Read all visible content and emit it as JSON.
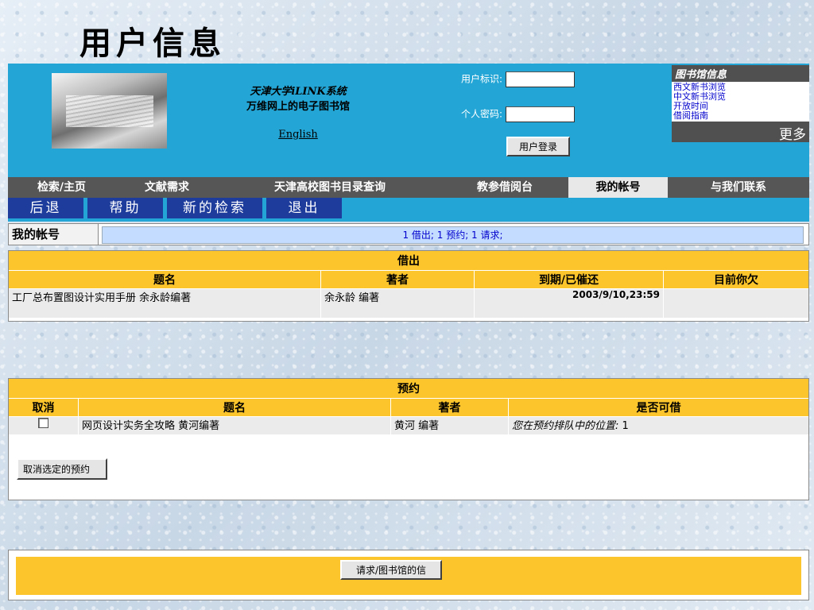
{
  "slide_title": "用户信息",
  "header": {
    "lib_line1": "天津大学iLINK系统",
    "lib_line2": "万维网上的电子图书馆",
    "english_link": "English",
    "user_id_label": "用户标识:",
    "password_label": "个人密码:",
    "login_button": "用户登录"
  },
  "library_info": {
    "title": "图书馆信息",
    "links": [
      "西文新书浏览",
      "中文新书浏览",
      "开放时间",
      "借阅指南"
    ],
    "more": "更多"
  },
  "nav": {
    "items": [
      "检索/主页",
      "文献需求",
      "天津高校图书目录查询",
      "教参借阅台",
      "我的帐号",
      "与我们联系"
    ],
    "active": "我的帐号"
  },
  "subnav": {
    "items": [
      "后退",
      "帮助",
      "新的检索",
      "退出"
    ]
  },
  "account": {
    "label": "我的帐号",
    "summary": "1 借出; 1 预约; 1 请求;"
  },
  "loans": {
    "title": "借出",
    "columns": [
      "题名",
      "著者",
      "到期/已催还",
      "目前你欠"
    ],
    "rows": [
      {
        "title": "工厂总布置图设计实用手册 余永龄编著",
        "author": "余永龄 编著",
        "due": "2003/9/10,23:59",
        "owed": ""
      }
    ]
  },
  "reservations": {
    "title": "预约",
    "columns": [
      "取消",
      "题名",
      "著者",
      "是否可借"
    ],
    "rows": [
      {
        "title": "网页设计实务全攻略 黄河编著",
        "author": "黄河 编著",
        "status_prefix": "您在预约排队中的位置:",
        "status_value": "1"
      }
    ],
    "cancel_button": "取消选定的预约"
  },
  "requests": {
    "button": "请求/图书馆的信"
  },
  "colors": {
    "header_blue": "#23a6d6",
    "nav_gray": "#565656",
    "yellow": "#fcc52c",
    "subnav_blue": "#1e3c9c"
  }
}
